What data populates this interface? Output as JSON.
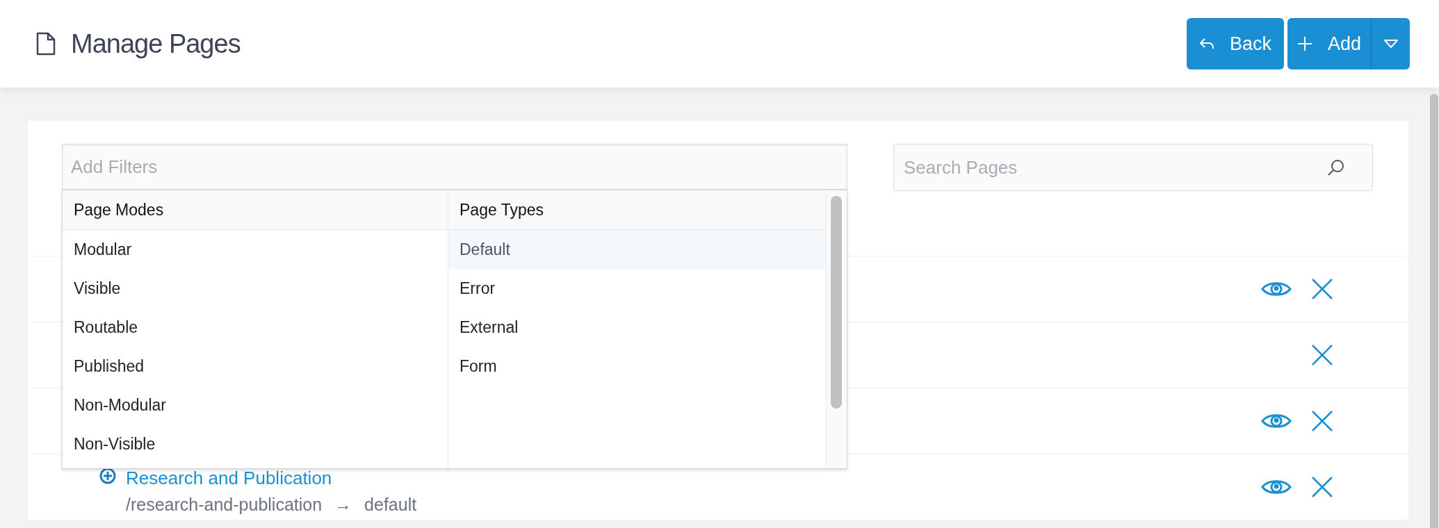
{
  "header": {
    "title": "Manage Pages",
    "back_button": "Back",
    "add_button": "Add"
  },
  "filter": {
    "placeholder": "Add Filters",
    "columns": [
      {
        "heading": "Page Modes",
        "options": [
          {
            "label": "Modular",
            "selected": false
          },
          {
            "label": "Visible",
            "selected": false
          },
          {
            "label": "Routable",
            "selected": false
          },
          {
            "label": "Published",
            "selected": false
          },
          {
            "label": "Non-Modular",
            "selected": false
          },
          {
            "label": "Non-Visible",
            "selected": false
          }
        ]
      },
      {
        "heading": "Page Types",
        "options": [
          {
            "label": "Default",
            "selected": true
          },
          {
            "label": "Error",
            "selected": false
          },
          {
            "label": "External",
            "selected": false
          },
          {
            "label": "Form",
            "selected": false
          }
        ]
      }
    ]
  },
  "search": {
    "placeholder": "Search Pages"
  },
  "rows": [
    {
      "viewable": true
    },
    {
      "viewable": false
    },
    {
      "viewable": true
    },
    {
      "title": "Research and Publication",
      "route": "/research-and-publication",
      "arrow": "→",
      "template": "default",
      "viewable": true
    }
  ]
}
